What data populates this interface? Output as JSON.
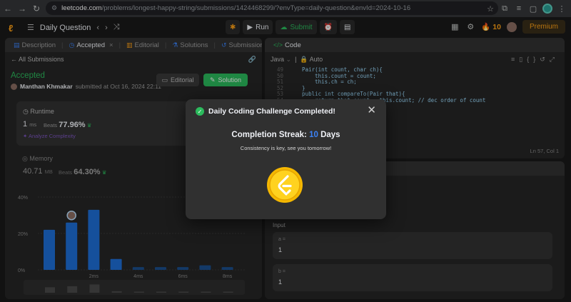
{
  "browser": {
    "url_host": "leetcode.com",
    "url_rest": "/problems/longest-happy-string/submissions/1424468299/?envType=daily-question&envId=2024-10-16"
  },
  "toolbar": {
    "daily_question": "Daily Question",
    "run": "Run",
    "submit": "Submit",
    "streak_count": "10",
    "premium": "Premium"
  },
  "left_tabs": [
    {
      "label": "Description"
    },
    {
      "label": "Accepted"
    },
    {
      "label": "Editorial"
    },
    {
      "label": "Solutions"
    },
    {
      "label": "Submissions"
    }
  ],
  "submission": {
    "back_label": "All Submissions",
    "status": "Accepted",
    "author": "Manthan Khmakar",
    "submitted_text": "submitted at Oct 16, 2024 22:11",
    "editorial_button": "Editorial",
    "solution_button": "Solution"
  },
  "runtime": {
    "label": "Runtime",
    "value": "1",
    "unit": "ms",
    "beats_label": "Beats",
    "beats_value": "77.96%",
    "analyze": "Analyze Complexity"
  },
  "memory": {
    "label": "Memory",
    "value": "40.71",
    "unit": "MB",
    "beats_label": "Beats",
    "beats_value": "64.30%"
  },
  "chart_data": {
    "type": "bar",
    "y_ticks": [
      "40%",
      "20%",
      "0%"
    ],
    "ylim": [
      0,
      40
    ],
    "values": [
      22,
      26,
      33,
      6,
      1.5,
      1.5,
      1.5,
      2.5,
      1.5
    ],
    "x_tick_labels": [
      "",
      "",
      "2ms",
      "",
      "4ms",
      "",
      "6ms",
      "",
      "8ms"
    ],
    "highlight_index": 1
  },
  "code_panel": {
    "title": "Code",
    "language": "Java",
    "mode": "Auto",
    "lines": [
      {
        "num": "49",
        "text": "    Pair(int count, char ch){"
      },
      {
        "num": "50",
        "text": "        this.count = count;"
      },
      {
        "num": "51",
        "text": "        this.ch = ch;"
      },
      {
        "num": "52",
        "text": "    }"
      },
      {
        "num": "53",
        "text": "    public int compareTo(Pair that){"
      },
      {
        "num": "54",
        "text": "        return that.count - this.count; // dec order of count"
      }
    ],
    "position": "Ln 57, Col 1"
  },
  "testcase": {
    "input_label": "Input",
    "cases": [
      {
        "key": "a =",
        "value": "1"
      },
      {
        "key": "b =",
        "value": "1"
      }
    ]
  },
  "modal": {
    "title": "Daily Coding Challenge Completed!",
    "streak_prefix": "Completion Streak:",
    "streak_value": "10",
    "streak_suffix": "Days",
    "message": "Consistency is key, see you tomorrow!"
  },
  "colors": {
    "accent_green": "#2cbb5d",
    "accent_orange": "#ffa116",
    "streak_blue": "#3b82f6",
    "bar_blue": "#1e6fd9"
  }
}
